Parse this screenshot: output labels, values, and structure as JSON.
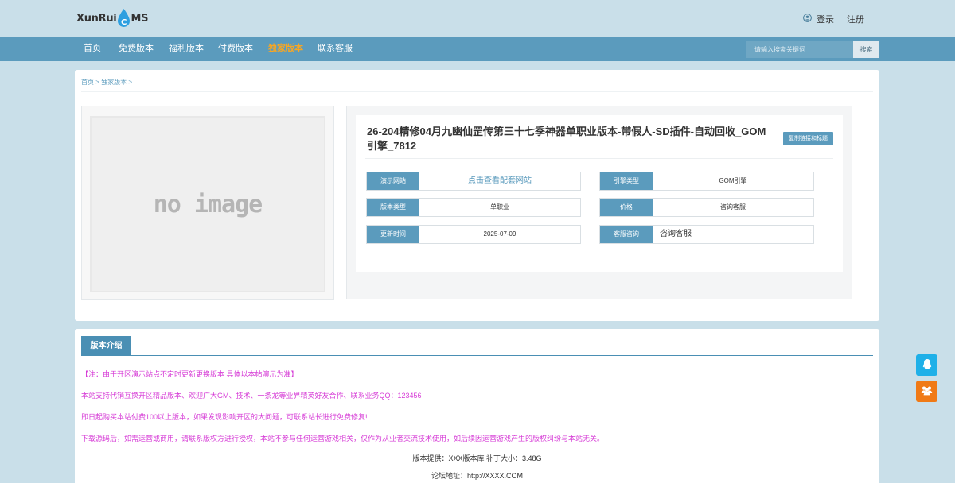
{
  "header": {
    "logo_text_left": "XunRui",
    "logo_letter": "C",
    "logo_text_right": "MS",
    "login_label": "登录",
    "register_label": "注册"
  },
  "nav": {
    "items": [
      "首页",
      "免费版本",
      "福利版本",
      "付费版本",
      "独家版本",
      "联系客服"
    ],
    "active_index": 4,
    "search_placeholder": "请输入搜索关键词",
    "search_button": "搜索"
  },
  "breadcrumb": {
    "home": "首页",
    "sep": ">",
    "category": "独家版本"
  },
  "product": {
    "image_placeholder": "no image",
    "title": "26-204精修04月九幽仙罡传第三十七季神器单职业版本-带假人-SD插件-自动回收_GOM引擎_7812",
    "copy_button": "复制链接和标题",
    "fields": [
      {
        "label": "演示网站",
        "value": "点击查看配套网站"
      },
      {
        "label": "引擎类型",
        "value": "GOM引擎"
      },
      {
        "label": "版本类型",
        "value": "单职业"
      },
      {
        "label": "价格",
        "value": "咨询客服"
      },
      {
        "label": "更新时间",
        "value": "2025-07-09"
      },
      {
        "label": "客服咨询",
        "value": "咨询客服"
      }
    ]
  },
  "intro": {
    "tab_label": "版本介绍",
    "paragraphs": [
      "【注：由于开区演示站点不定时更新更换版本 具体以本帖演示为准】",
      "本站支持代销互换开区精品版本、欢迎广大GM、技术、一条龙等业界精英好友合作、联系业务QQ：123456",
      "即日起购买本站付费100以上版本，如果发现影响开区的大问题，可联系站长进行免费修复!",
      "下载源码后，如需运营或商用，请联系版权方进行授权，本站不参与任何运营游戏相关，仅作为从业者交流技术使用，如后续因运营游戏产生的版权纠纷与本站无关。"
    ],
    "provider_line": "版本提供：XXX版本库  补丁大小：3.48G",
    "forum_line": "论坛地址：http://XXXX.COM"
  },
  "colors": {
    "nav_bg": "#5b9bbd",
    "active_nav": "#f7a623",
    "accent": "#4a8fb4",
    "notice_text": "#d63bd6",
    "qq_button": "#1fb0e8",
    "group_button": "#f07a16"
  },
  "float_buttons": {
    "qq_icon": "qq-icon",
    "group_icon": "group-icon"
  }
}
